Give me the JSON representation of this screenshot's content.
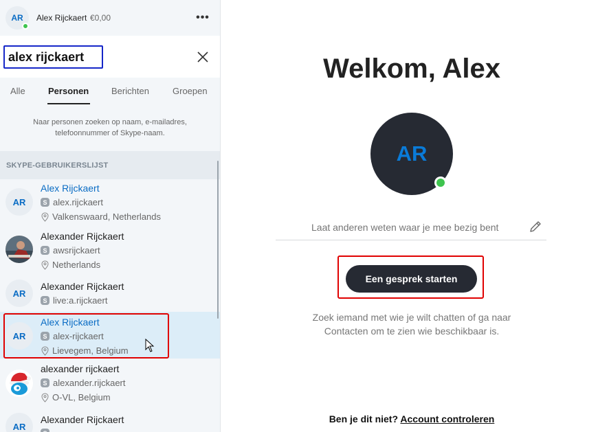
{
  "profile": {
    "initials": "AR",
    "name": "Alex Rijckaert",
    "credit": "€0,00",
    "more_label": "•••"
  },
  "search": {
    "value": "alex rijckaert",
    "placeholder": ""
  },
  "tabs": [
    {
      "label": "Alle",
      "active": false
    },
    {
      "label": "Personen",
      "active": true
    },
    {
      "label": "Berichten",
      "active": false
    },
    {
      "label": "Groepen",
      "active": false
    }
  ],
  "hint": {
    "line1": "Naar personen zoeken op naam, e-mailadres,",
    "line2": "telefoonnummer of Skype-naam."
  },
  "section_header": "SKYPE-GEBRUIKERSLIJST",
  "results": [
    {
      "name": "Alex Rijckaert",
      "username": "alex.rijckaert",
      "location": "Valkenswaard, Netherlands",
      "avatar": "AR",
      "name_color": "#0a6cc4"
    },
    {
      "name": "Alexander Rijckaert",
      "username": "awsrijckaert",
      "location": "Netherlands",
      "avatar": "photo-avatar",
      "name_color": "#222222"
    },
    {
      "name": "Alexander Rijckaert",
      "username": "live:a.rijckaert",
      "location": "",
      "avatar": "AR",
      "name_color": "#222222"
    },
    {
      "name": "Alex Rijckaert",
      "username": "alex-rijckaert",
      "location": "Lievegem, Belgium",
      "avatar": "AR",
      "name_color": "#0a6cc4"
    },
    {
      "name": "alexander rijckaert",
      "username": "alexander.rijckaert",
      "location": "O-VL, Belgium",
      "avatar": "christmas-avatar",
      "name_color": "#222222"
    },
    {
      "name": "Alexander Rijckaert",
      "username": "",
      "location": "",
      "avatar": "AR",
      "name_color": "#222222"
    }
  ],
  "main": {
    "welcome": "Welkom, Alex",
    "avatar_initials": "AR",
    "mood_placeholder": "Laat anderen weten waar je mee bezig bent",
    "start_button": "Een gesprek starten",
    "hint_line1": "Zoek iemand met wie je wilt chatten of ga naar",
    "hint_line2": "Contacten om te zien wie beschikbaar is.",
    "footer_question": "Ben je dit niet?",
    "footer_link": "Account controleren"
  },
  "colors": {
    "accent": "#0a6cc4",
    "online": "#3fc44f",
    "dark_button": "#262a33",
    "annotation_red": "#e00000",
    "search_border": "#1526c8"
  }
}
